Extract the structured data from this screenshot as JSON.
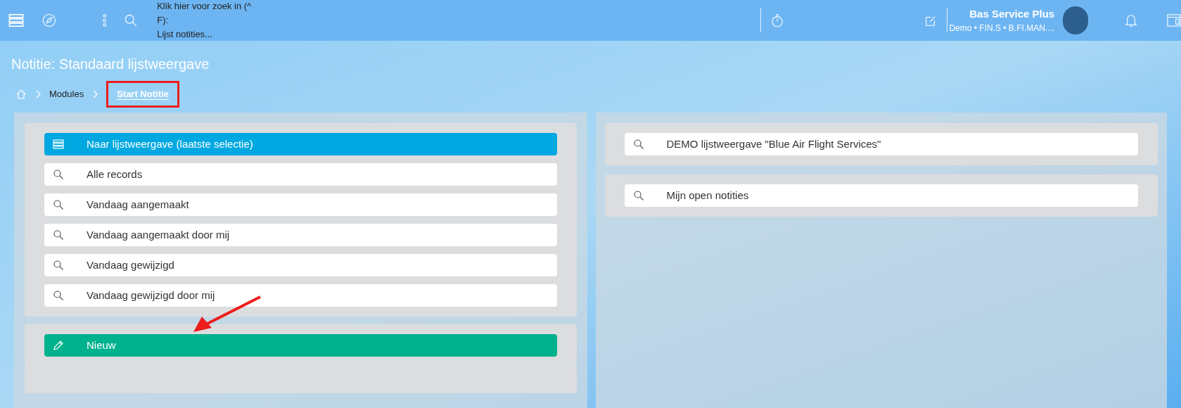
{
  "topbar": {
    "search_hint_line1": "Klik hier voor zoek in (^ F):",
    "search_hint_line2": "Lijst notities...",
    "user_name": "Bas Service Plus",
    "user_detail": "Demo • FIN.S • B.FI.MAN...."
  },
  "page_title": "Notitie: Standaard lijstweergave",
  "breadcrumb": [
    {
      "label": "Modules",
      "selected": false,
      "highlighted": false
    },
    {
      "label": "Start Notitie",
      "selected": true,
      "highlighted": true
    }
  ],
  "left_groups": [
    {
      "items": [
        {
          "kind": "list",
          "label": "Naar lijstweergave (laatste selectie)"
        },
        {
          "kind": "search",
          "label": "Alle records"
        },
        {
          "kind": "search",
          "label": "Vandaag aangemaakt"
        },
        {
          "kind": "search",
          "label": "Vandaag aangemaakt door mij"
        },
        {
          "kind": "search",
          "label": "Vandaag gewijzigd"
        },
        {
          "kind": "search",
          "label": "Vandaag gewijzigd door mij"
        }
      ]
    },
    {
      "items": [
        {
          "kind": "new",
          "label": "Nieuw"
        }
      ]
    }
  ],
  "right_groups": [
    {
      "items": [
        {
          "kind": "search",
          "label": "DEMO lijstweergave \"Blue Air Flight Services\""
        }
      ]
    },
    {
      "items": [
        {
          "kind": "search",
          "label": "Mijn open notities"
        }
      ]
    }
  ]
}
